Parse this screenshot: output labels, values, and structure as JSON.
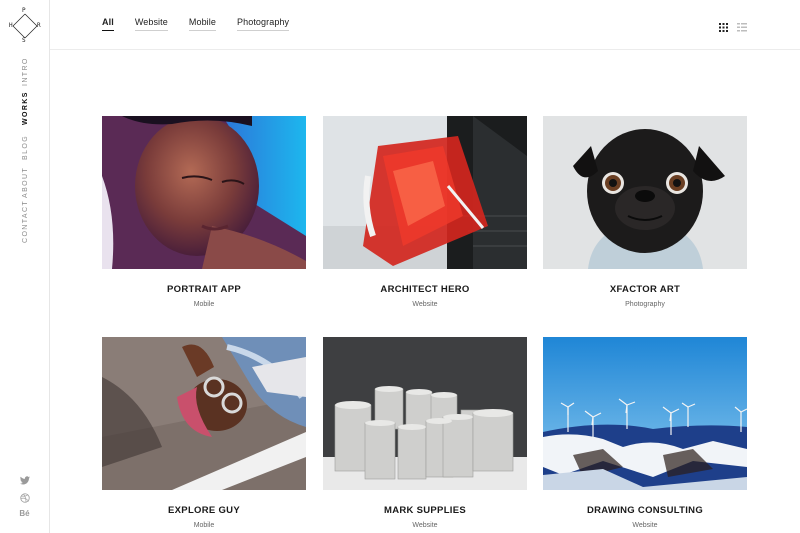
{
  "brand": {
    "letters": [
      "P",
      "H",
      "R",
      "S"
    ]
  },
  "sidebar": {
    "items": [
      {
        "label": "INTRO",
        "active": false
      },
      {
        "label": "WORKS",
        "active": true
      },
      {
        "label": "BLOG",
        "active": false
      },
      {
        "label": "ABOUT",
        "active": false
      },
      {
        "label": "CONTACT",
        "active": false
      }
    ],
    "social": {
      "behance_label": "Bé"
    }
  },
  "filters": [
    {
      "label": "All",
      "active": true
    },
    {
      "label": "Website",
      "active": false
    },
    {
      "label": "Mobile",
      "active": false
    },
    {
      "label": "Photography",
      "active": false
    }
  ],
  "view_toggle": {
    "active": "grid"
  },
  "works": [
    {
      "title": "PORTRAIT APP",
      "category": "Mobile"
    },
    {
      "title": "ARCHITECT HERO",
      "category": "Website"
    },
    {
      "title": "XFACTOR ART",
      "category": "Photography"
    },
    {
      "title": "EXPLORE GUY",
      "category": "Mobile"
    },
    {
      "title": "MARK SUPPLIES",
      "category": "Website"
    },
    {
      "title": "DRAWING CONSULTING",
      "category": "Website"
    }
  ],
  "colors": {
    "text": "#222222",
    "muted": "#8b8b8b",
    "divider": "#e6e6e6"
  }
}
